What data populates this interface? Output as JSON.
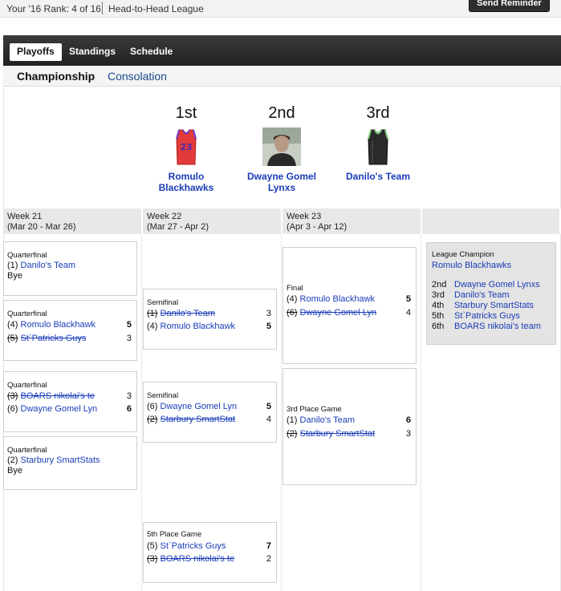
{
  "topbar": {
    "rank": "Your '16 Rank: 4 of 16",
    "league_type": "Head-to-Head League",
    "send_reminder": "Send Reminder"
  },
  "tabs": [
    "Playoffs",
    "Standings",
    "Schedule"
  ],
  "subtabs": [
    "Championship",
    "Consolation"
  ],
  "podium": [
    {
      "place": "1st",
      "team": "Romulo Blackhawks",
      "icon": "red-jersey-icon"
    },
    {
      "place": "2nd",
      "team": "Dwayne Gomel Lynxs",
      "icon": "avatar-photo"
    },
    {
      "place": "3rd",
      "team": "Danilo's Team",
      "icon": "black-jersey-icon"
    }
  ],
  "weeks": [
    {
      "label": "Week 21",
      "range": "(Mar 20 - Mar 26)"
    },
    {
      "label": "Week 22",
      "range": "(Mar 27 - Apr 2)"
    },
    {
      "label": "Week 23",
      "range": "(Apr 3 - Apr 12)"
    }
  ],
  "games": {
    "qf1": {
      "title": "Quarterfinal",
      "seed1": "(1)",
      "team1": "Danilo's Team",
      "bye": "Bye"
    },
    "qf2": {
      "title": "Quarterfinal",
      "seed1": "(4)",
      "team1": "Romulo Blackhawk",
      "score1": "5",
      "seed2": "(5)",
      "team2": "St`Patricks Guys",
      "score2": "3"
    },
    "qf3": {
      "title": "Quarterfinal",
      "seed1": "(3)",
      "team1": "BOARS nikolai's te",
      "score1": "3",
      "seed2": "(6)",
      "team2": "Dwayne Gomel Lyn",
      "score2": "6"
    },
    "qf4": {
      "title": "Quarterfinal",
      "seed1": "(2)",
      "team1": "Starbury SmartStats",
      "bye": "Bye"
    },
    "sf1": {
      "title": "Semifinal",
      "seed1": "(1)",
      "team1": "Danilo's Team",
      "score1": "3",
      "seed2": "(4)",
      "team2": "Romulo Blackhawk",
      "score2": "5"
    },
    "sf2": {
      "title": "Semifinal",
      "seed1": "(6)",
      "team1": "Dwayne Gomel Lyn",
      "score1": "5",
      "seed2": "(2)",
      "team2": "Starbury SmartStat",
      "score2": "4"
    },
    "fifth": {
      "title": "5th Place Game",
      "seed1": "(5)",
      "team1": "St`Patricks Guys",
      "score1": "7",
      "seed2": "(3)",
      "team2": "BOARS nikolai's te",
      "score2": "2"
    },
    "final": {
      "title": "Final",
      "seed1": "(4)",
      "team1": "Romulo Blackhawk",
      "score1": "5",
      "seed2": "(6)",
      "team2": "Dwayne Gomel Lyn",
      "score2": "4"
    },
    "third": {
      "title": "3rd Place Game",
      "seed1": "(1)",
      "team1": "Danilo's Team",
      "score1": "6",
      "seed2": "(2)",
      "team2": "Starbury SmartStat",
      "score2": "3"
    }
  },
  "champion": {
    "label": "League Champion",
    "team": "Romulo Blackhawks",
    "finishes": [
      {
        "place": "2nd",
        "team": "Dwayne Gomel Lynxs"
      },
      {
        "place": "3rd",
        "team": "Danilo's Team"
      },
      {
        "place": "4th",
        "team": "Starbury SmartStats"
      },
      {
        "place": "5th",
        "team": "St`Patricks Guys"
      },
      {
        "place": "6th",
        "team": "BOARS nikolai's team"
      }
    ]
  },
  "colors": {
    "link": "#1a3cb8",
    "tabbar": "#2b2b2b",
    "jersey_red": "#e23a3a",
    "jersey_black": "#2a2a2a"
  }
}
